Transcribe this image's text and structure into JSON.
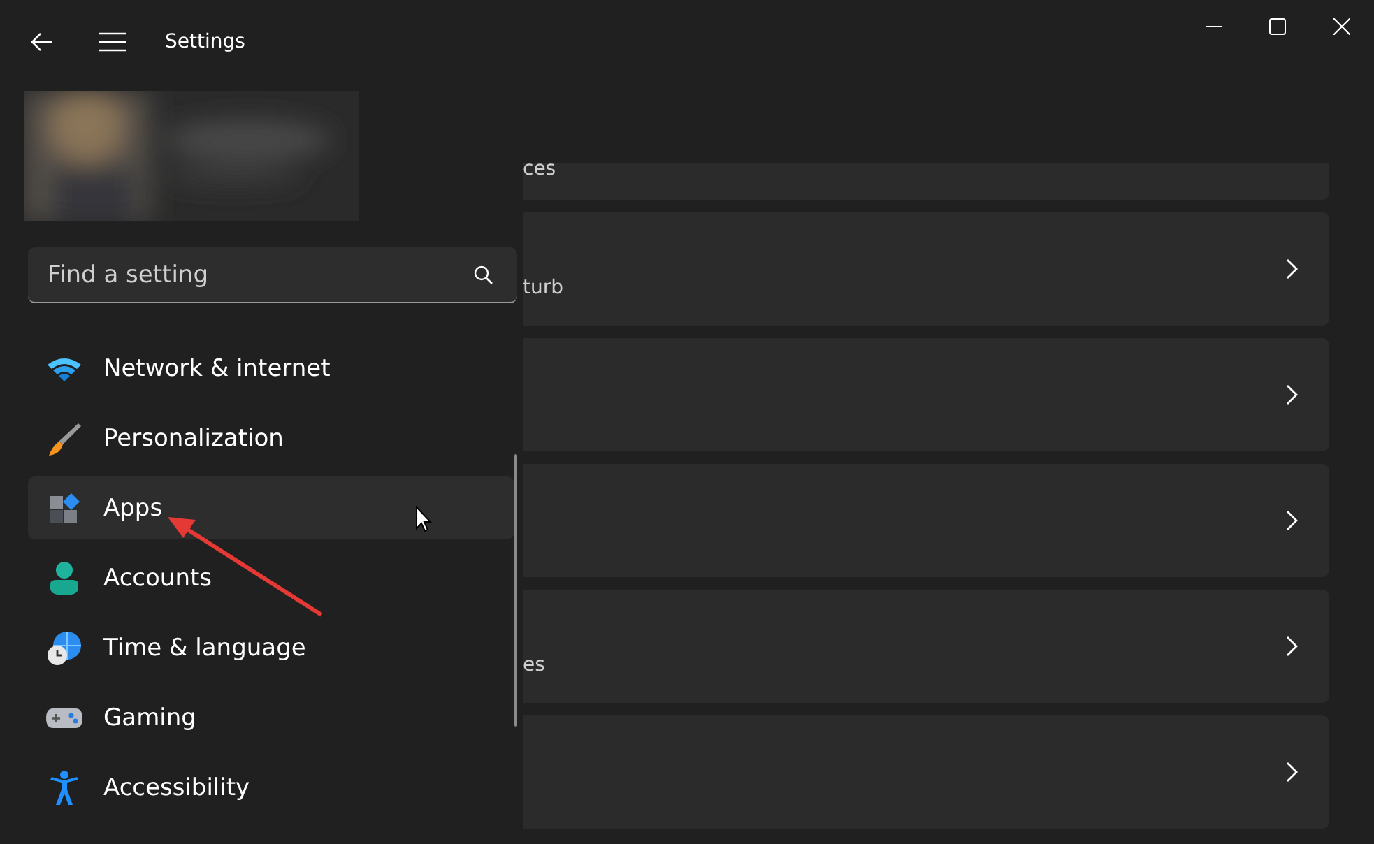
{
  "window": {
    "title": "Settings"
  },
  "search": {
    "placeholder": "Find a setting"
  },
  "nav": {
    "items": [
      {
        "label": "Network & internet",
        "selected": false
      },
      {
        "label": "Personalization",
        "selected": false
      },
      {
        "label": "Apps",
        "selected": true
      },
      {
        "label": "Accounts",
        "selected": false
      },
      {
        "label": "Time & language",
        "selected": false
      },
      {
        "label": "Gaming",
        "selected": false
      },
      {
        "label": "Accessibility",
        "selected": false
      }
    ]
  },
  "cards": [
    {
      "kind": "clipped",
      "subtitle": "ces"
    },
    {
      "kind": "row",
      "subtitle": "turb"
    },
    {
      "kind": "row"
    },
    {
      "kind": "row"
    },
    {
      "kind": "row",
      "subtitle": "es"
    },
    {
      "kind": "row"
    }
  ]
}
